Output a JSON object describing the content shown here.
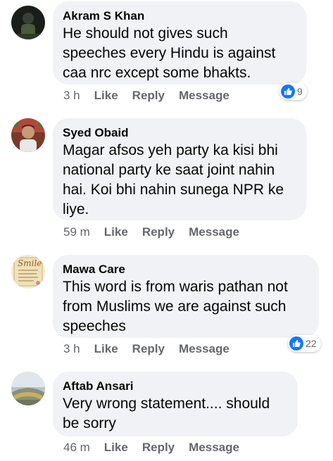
{
  "comments": [
    {
      "author": "Akram S Khan",
      "lines": [
        "He should not gives such",
        "speeches every Hindu is against",
        "caa nrc except some bhakts."
      ],
      "time": "3 h",
      "actions": [
        "Like",
        "Reply",
        "Message"
      ],
      "reactions": "9",
      "avatar_icon": "person-avatar-icon"
    },
    {
      "author": "Syed Obaid",
      "lines": [
        "Magar afsos yeh party ka kisi bhi",
        "national party ke saat joint nahin",
        "hai. Koi bhi nahin sunega NPR ke",
        "liye."
      ],
      "time": "59 m",
      "actions": [
        "Like",
        "Reply",
        "Message"
      ],
      "reactions": "",
      "avatar_icon": "person-avatar-icon"
    },
    {
      "author": "Mawa Care",
      "lines": [
        "This word is from waris pathan not",
        "from Muslims we are against such",
        "speeches"
      ],
      "time": "3 h",
      "actions": [
        "Like",
        "Reply",
        "Message"
      ],
      "reactions": "22",
      "avatar_icon": "smile-card-avatar-icon",
      "avatar_text": "Smile"
    },
    {
      "author": "Aftab Ansari",
      "lines": [
        "Very wrong statement.... should",
        "be sorry"
      ],
      "time": "46 m",
      "actions": [
        "Like",
        "Reply",
        "Message"
      ],
      "reactions": "",
      "avatar_icon": "landscape-avatar-icon"
    }
  ],
  "colors": {
    "bubble": "#f0f2f5",
    "meta": "#65676b",
    "like_blue": "#1877f2"
  }
}
